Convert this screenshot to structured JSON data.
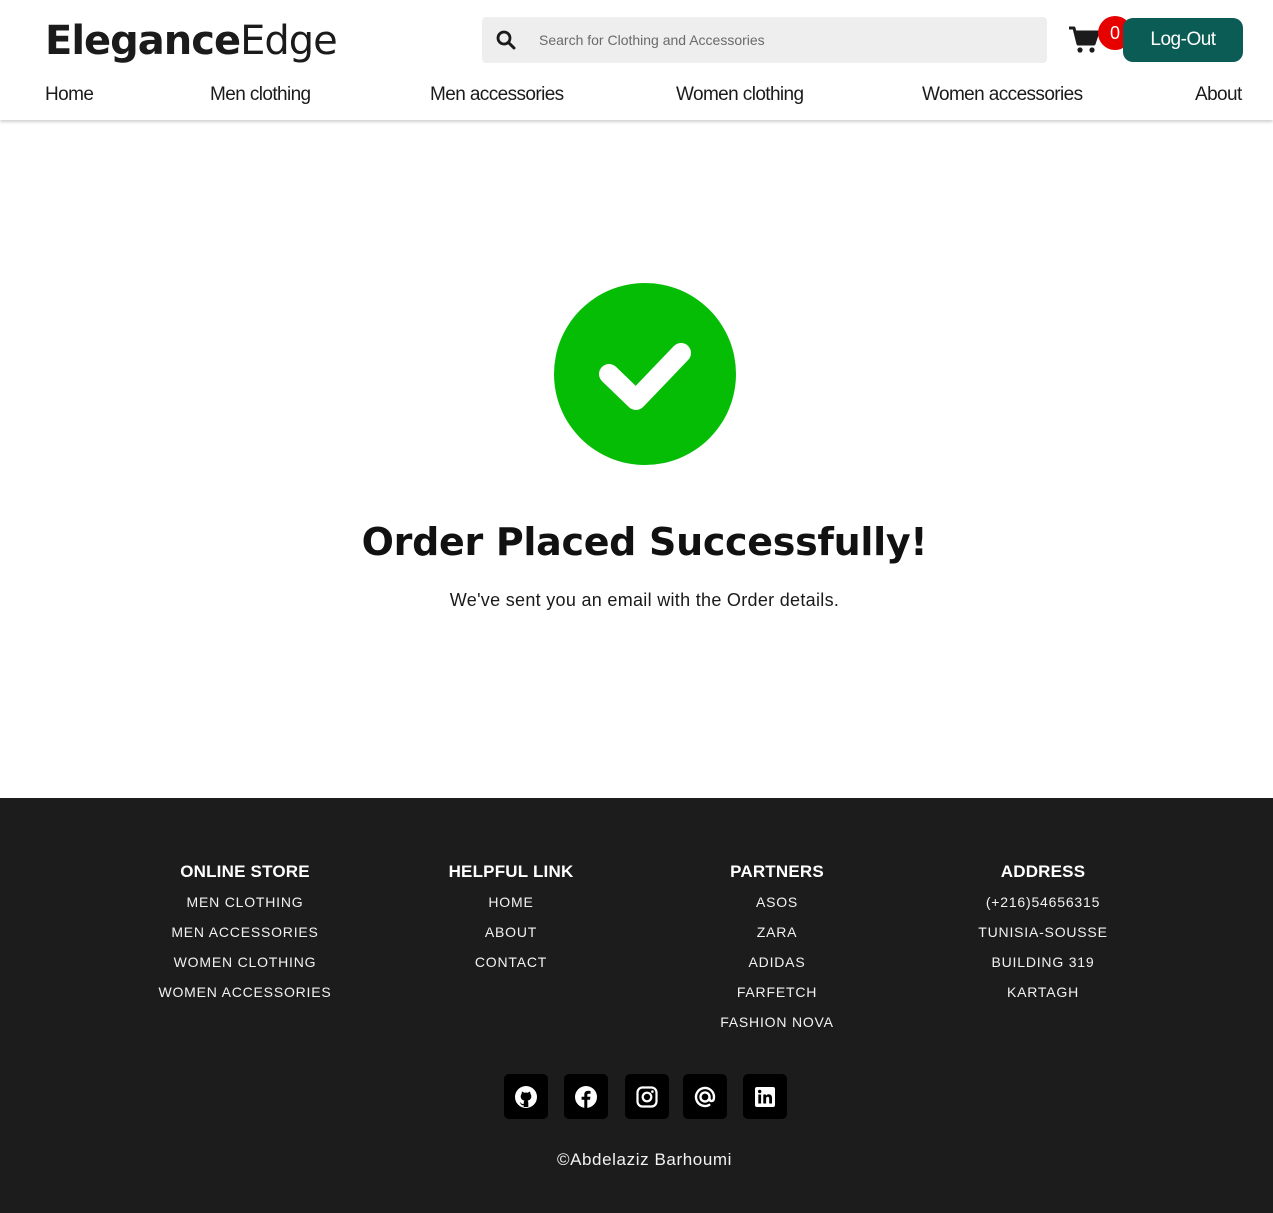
{
  "header": {
    "logo_bold": "Elegance",
    "logo_light": "Edge",
    "search_placeholder": "Search for Clothing and Accessories",
    "cart_count": "0",
    "logout_label": "Log-Out"
  },
  "nav": {
    "items": [
      "Home",
      "Men clothing",
      "Men accessories",
      "Women clothing",
      "Women accessories",
      "About"
    ]
  },
  "main": {
    "title": "Order Placed Successfully!",
    "subtitle": "We've sent you an email with the Order details.",
    "accent_color": "#06bd06"
  },
  "footer": {
    "online_store": {
      "heading": "ONLINE STORE",
      "items": [
        "MEN CLOTHING",
        "MEN ACCESSORIES",
        "WOMEN CLOTHING",
        "WOMEN ACCESSORIES"
      ]
    },
    "helpful_link": {
      "heading": "HELPFUL LINK",
      "items": [
        "HOME",
        "ABOUT",
        "CONTACT"
      ]
    },
    "partners": {
      "heading": "PARTNERS",
      "items": [
        "ASOS",
        "ZARA",
        "ADIDAS",
        "FARFETCH",
        "FASHION NOVA"
      ]
    },
    "address": {
      "heading": "ADDRESS",
      "items": [
        "(+216)54656315",
        "TUNISIA-SOUSSE",
        "BUILDING 319",
        "KARTAGH"
      ]
    },
    "social_icons": [
      "github-icon",
      "facebook-icon",
      "instagram-icon",
      "email-at-icon",
      "linkedin-icon"
    ],
    "copyright": "©Abdelaziz Barhoumi"
  },
  "colors": {
    "brand_button": "#0b5c55",
    "badge": "#e60000",
    "success": "#06bd06",
    "footer_bg": "#1c1c1c"
  }
}
